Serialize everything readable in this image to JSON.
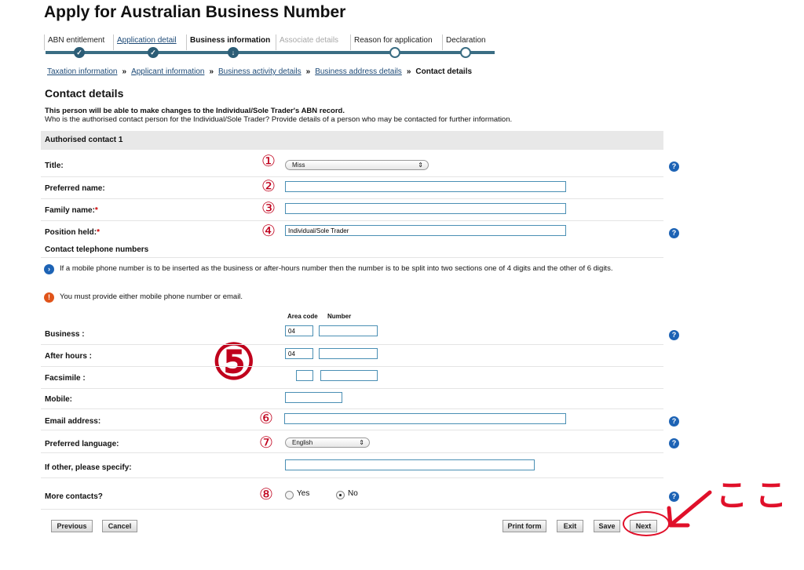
{
  "page_title": "Apply for Australian Business Number",
  "progress_tabs": [
    {
      "label": "ABN entitlement",
      "state": "done"
    },
    {
      "label": "Application detail",
      "state": "link"
    },
    {
      "label": "Business information",
      "state": "current"
    },
    {
      "label": "Associate details",
      "state": "disabled"
    },
    {
      "label": "Reason for application",
      "state": "done"
    },
    {
      "label": "Declaration",
      "state": "done"
    }
  ],
  "breadcrumb": {
    "items": [
      "Taxation information",
      "Applicant information",
      "Business activity details",
      "Business address details"
    ],
    "separator": "»",
    "current": "Contact details"
  },
  "section_title": "Contact details",
  "intro": {
    "bold": "This person will be able to make changes to the Individual/Sole Trader's ABN record.",
    "text": "Who is the authorised contact person for the Individual/Sole Trader? Provide details of a person who may be contacted for further information."
  },
  "band_title": "Authorised contact 1",
  "fields": {
    "title": {
      "label": "Title:",
      "value": "Miss",
      "annot": "①"
    },
    "preferred_name": {
      "label": "Preferred name:",
      "value": "",
      "annot": "②"
    },
    "family_name": {
      "label": "Family name:",
      "required": "*",
      "value": "",
      "annot": "③"
    },
    "position": {
      "label": "Position held:",
      "required": "*",
      "value": "Individual/Sole Trader",
      "annot": "④"
    },
    "email": {
      "label": "Email address:",
      "value": "",
      "annot": "⑥"
    },
    "language": {
      "label": "Preferred language:",
      "value": "English",
      "annot": "⑦"
    },
    "other": {
      "label": "If other, please specify:",
      "value": ""
    },
    "more": {
      "label": "More contacts?",
      "yes": "Yes",
      "no": "No",
      "selected": "No",
      "annot": "⑧"
    }
  },
  "phones": {
    "heading": "Contact telephone numbers",
    "info_note": "If a mobile phone number is to be inserted as the business or after-hours number then the number is to be split into two sections one of 4 digits and the other of 6 digits.",
    "warn_note": "You must provide either mobile phone number or email.",
    "area_code_hdr": "Area code",
    "number_hdr": "Number",
    "annot": "⑤",
    "business": {
      "label": "Business :",
      "area": "04",
      "number": ""
    },
    "after_hours": {
      "label": "After hours :",
      "area": "04",
      "number": ""
    },
    "facsimile": {
      "label": "Facsimile :",
      "area": "",
      "number": ""
    },
    "mobile": {
      "label": "Mobile:",
      "number": ""
    }
  },
  "buttons": {
    "previous": "Previous",
    "cancel": "Cancel",
    "print": "Print form",
    "exit": "Exit",
    "save": "Save",
    "next": "Next"
  },
  "annotation_text": "ここ",
  "colors": {
    "accent": "#3a6d83",
    "annot_red": "#e0102a",
    "help_blue": "#1d63b5",
    "warn_orange": "#e0541a"
  }
}
